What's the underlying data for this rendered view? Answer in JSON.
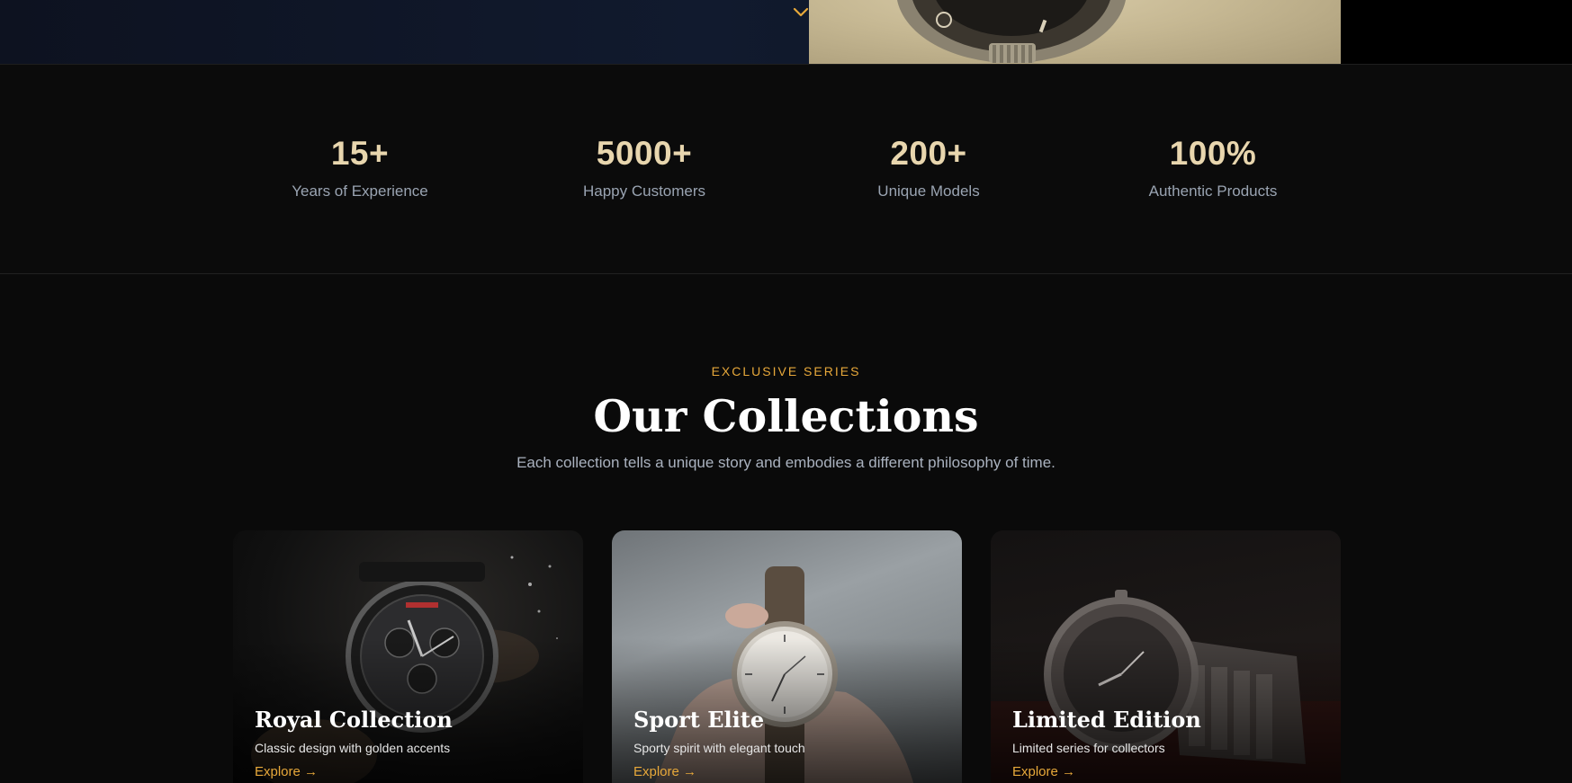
{
  "hero": {
    "scroll_icon": "chevron-down-icon",
    "accent_color": "#e7a83a"
  },
  "stats": [
    {
      "value": "15+",
      "label": "Years of Experience"
    },
    {
      "value": "5000+",
      "label": "Happy Customers"
    },
    {
      "value": "200+",
      "label": "Unique Models"
    },
    {
      "value": "100%",
      "label": "Authentic Products"
    }
  ],
  "collections": {
    "eyebrow": "EXCLUSIVE SERIES",
    "title": "Our Collections",
    "subtitle": "Each collection tells a unique story and embodies a different philosophy of time.",
    "cards": [
      {
        "title": "Royal Collection",
        "description": "Classic design with golden accents",
        "link": "Explore →"
      },
      {
        "title": "Sport Elite",
        "description": "Sporty spirit with elegant touch",
        "link": "Explore →"
      },
      {
        "title": "Limited Edition",
        "description": "Limited series for collectors",
        "link": "Explore →"
      }
    ]
  },
  "colors": {
    "accent": "#e7a83a",
    "stat_value": "#e8d6ae",
    "muted_text": "#9aa4b2",
    "background": "#0a0a0a"
  }
}
